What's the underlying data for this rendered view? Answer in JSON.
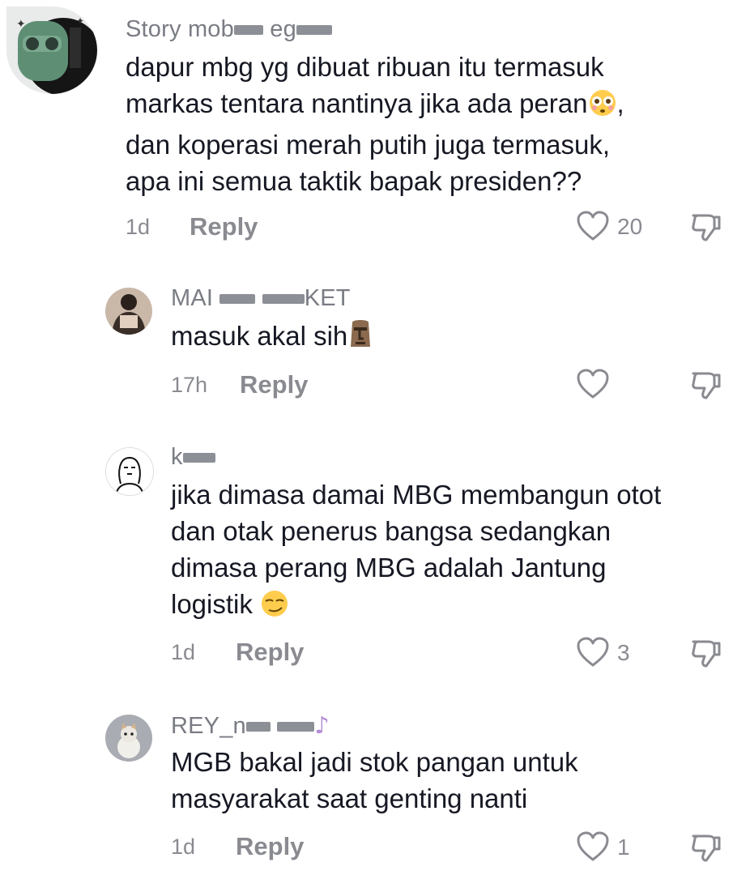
{
  "comments": [
    {
      "username_visible": "Story mob",
      "username_tail": "eg",
      "text_lines": [
        "dapur mbg yg dibuat ribuan itu termasuk",
        "markas tentara nantinya jika ada peran",
        "dan koperasi merah putih juga termasuk,",
        "apa ini semua taktik bapak presiden??"
      ],
      "emoji": "flushed-face",
      "time": "1d",
      "reply_label": "Reply",
      "like_count": "20"
    },
    {
      "username_visible": "MAI",
      "username_tail": "KET",
      "text_lines": [
        "masuk akal sih"
      ],
      "emoji": "moai",
      "time": "17h",
      "reply_label": "Reply",
      "like_count": ""
    },
    {
      "username_visible": "k",
      "username_tail": "",
      "text_lines": [
        "jika dimasa damai MBG membangun otot",
        "dan otak penerus bangsa sedangkan",
        "dimasa perang MBG adalah Jantung",
        "logistik"
      ],
      "emoji": "smirking-face",
      "time": "1d",
      "reply_label": "Reply",
      "like_count": "3"
    },
    {
      "username_visible": "REY_n",
      "username_tail": "",
      "text_lines": [
        "MGB bakal jadi stok pangan untuk",
        "masyarakat saat genting nanti"
      ],
      "emoji": "",
      "time": "1d",
      "reply_label": "Reply",
      "like_count": "1"
    }
  ],
  "icons": {
    "like": "heart-outline-icon",
    "dislike": "thumbs-down-icon"
  },
  "colors": {
    "text": "#161823",
    "secondary": "#8a8b91"
  }
}
